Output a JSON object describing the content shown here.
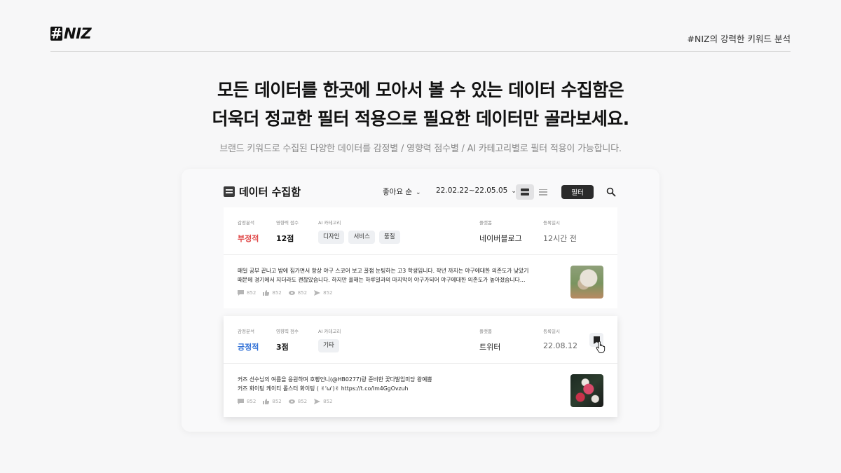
{
  "header": {
    "logo": "NIZ",
    "tagline": "#NIZ의 강력한 키워드 분석"
  },
  "hero": {
    "line1": "모든 데이터를 한곳에 모아서 볼 수 있는 데이터 수집함은",
    "line2": "더욱더 정교한 필터 적용으로 필요한 데이터만 골라보세요.",
    "subtitle": "브랜드 키워드로 수집된 다양한 데이터를 감정별 / 영향력 점수별 / AI 카테고리별로 필터 적용이 가능합니다."
  },
  "toolbar": {
    "title": "데이터 수집함",
    "sort_label": "좋아요 순",
    "date_range": "22.02.22~22.05.05",
    "filter_label": "필터"
  },
  "labels": {
    "sentiment": "감정분석",
    "score": "영향력 점수",
    "ai_category": "AI 카테고리",
    "platform": "플랫폼",
    "date": "등록일시"
  },
  "items": [
    {
      "sentiment": "부정적",
      "score": "12점",
      "categories": [
        "디자인",
        "서비스",
        "품질"
      ],
      "platform": "네이버블로그",
      "date": "12시간 전",
      "text_line1": "매일 공부 끝나고 밤에 집가면서 항상 야구 스코어 보고 꿀잼 눈팅하는 고3 학생입니다. 작년 까지는 야구에대한 의존도가 낮았기",
      "text_line2": "때문에 경기에서 지더라도 괜찮았습니다. 하지만 올해는 하루일과의 마지막이 야구가되어 야구에대한 의존도가 높아졌습니다…",
      "stats": {
        "comments": "852",
        "likes": "852",
        "views": "852",
        "shares": "852"
      }
    },
    {
      "sentiment": "긍정적",
      "score": "3점",
      "categories": [
        "기타"
      ],
      "platform": "트위터",
      "date": "22.08.12",
      "text_line1": "커즈 선수님의 여름을 응원하며 호빵언니(@HB0277)랑 준비한 꽃다발입미당 왕예쁨",
      "text_line2": "커즈 화이팅 케이티 롤스터 화이팅 ( ✌'ω')✌ https://t.co/Im4GgOvzuh",
      "stats": {
        "comments": "852",
        "likes": "852",
        "views": "852",
        "shares": "852"
      }
    }
  ],
  "colors": {
    "negative": "#e04848",
    "positive": "#2f6fd6",
    "accent_dark": "#2b2b2b"
  },
  "icons": [
    "folder-icon",
    "chevron-down-icon",
    "card-view-icon",
    "list-view-icon",
    "search-icon",
    "comment-icon",
    "thumbs-up-icon",
    "eye-icon",
    "share-icon",
    "bookmark-icon",
    "hand-cursor-icon"
  ]
}
